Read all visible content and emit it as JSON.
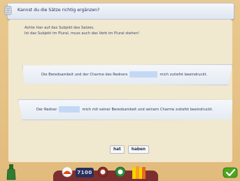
{
  "header": {
    "title": "Kannst du die Sätze richtig ergänzen?"
  },
  "hint": {
    "line1": "Achte hier auf das Subjekt des Satzes.",
    "line2": "Ist das Subjekt im Plural, muss auch das Verb im Plural stehen!"
  },
  "sentences": [
    {
      "before": "Die Beredsamkeit und der Charme des Redners",
      "after": "mich zutiefst beeindruckt."
    },
    {
      "before": "Der Redner",
      "after": "mich mit seiner Beredsamkeit und seinem Charme zutiefst beeindruckt."
    }
  ],
  "choices": [
    "hat",
    "haben"
  ],
  "toolbar": {
    "counter": "7100",
    "icons": [
      "bottle-icon",
      "hat-icon",
      "counter-display",
      "magnifier-icon",
      "clock-icon",
      "books-icon",
      "check-icon"
    ]
  },
  "colors": {
    "background": "#e7c488",
    "blank": "#c3d8f5",
    "check_button": "#4ea51f"
  }
}
